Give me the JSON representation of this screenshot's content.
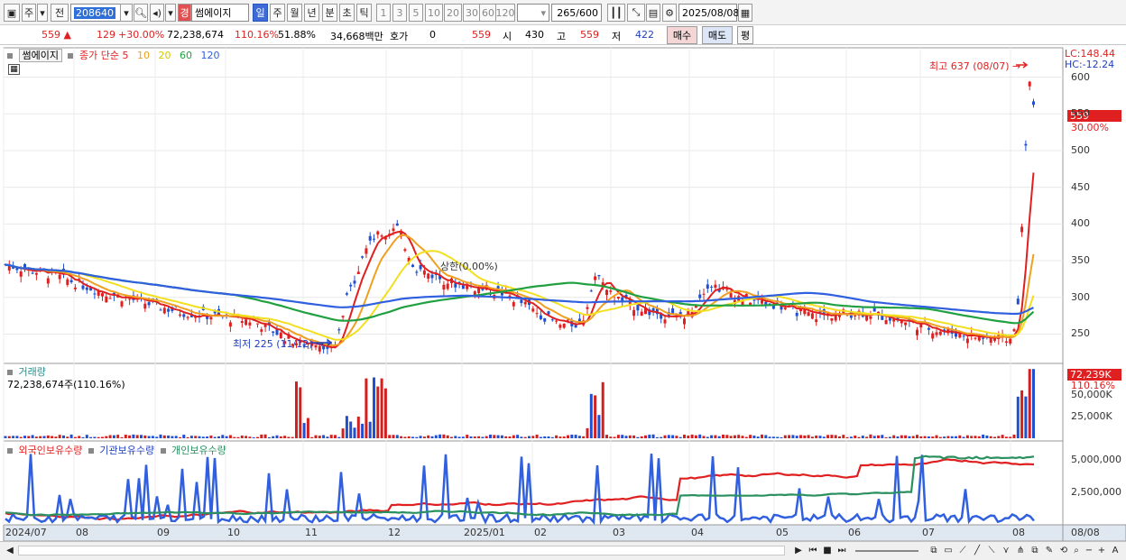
{
  "toolbar": {
    "period_prefix": "주",
    "period_full": "전",
    "stock_code": "208640",
    "stock_badge": "경",
    "stock_name": "썸에이지",
    "interval_tabs": [
      "일",
      "주",
      "월",
      "년",
      "분",
      "초",
      "틱"
    ],
    "active_interval": "일",
    "minute_options": [
      "1",
      "3",
      "5",
      "10",
      "20",
      "30",
      "60",
      "120"
    ],
    "count_value": "265",
    "count_total": "/600",
    "date_value": "2025/08/08"
  },
  "quote": {
    "price": "559",
    "change": "129",
    "change_pct": "+30.00%",
    "volume": "72,238,674",
    "volume_ratio": "110.16%",
    "turnover": "51.88%",
    "amount": "34,668백만",
    "bid_label": "호가",
    "bid_value": "0",
    "ask_value": "559",
    "open_label": "시",
    "open_value": "430",
    "high_label": "고",
    "high_value": "559",
    "low_label": "저",
    "low_value": "422",
    "buy_label": "매수",
    "sell_label": "매도",
    "eval_label": "평"
  },
  "price_panel": {
    "stock_tab": "썸에이지",
    "ma_label": "종가 단순",
    "ma_periods": [
      "5",
      "10",
      "20",
      "60",
      "120"
    ],
    "ma_colors": [
      "#e02020",
      "#f0a020",
      "#f2e020",
      "#20a040",
      "#3060e0"
    ],
    "lc_label": "LC:148.44",
    "hc_label": "HC:-12.24",
    "high_note": "최고 637 (08/07) →",
    "low_note": "최저 225 (11/12) →",
    "mid_note": "상한(0.00%)",
    "price_tag": "559",
    "price_tag_pct": "30.00%",
    "y_ticks": [
      "600",
      "550",
      "500",
      "450",
      "400",
      "350",
      "300",
      "250"
    ]
  },
  "volume_panel": {
    "title": "거래량",
    "summary": "72,238,674주(110.16%)",
    "vol_tag": "72,239K",
    "vol_tag_pct": "110.16%",
    "y_ticks": [
      "50,000K",
      "25,000K"
    ]
  },
  "holding_panel": {
    "series": [
      "외국인보유수량",
      "기관보유수량",
      "개인보유수량"
    ],
    "series_colors": [
      "#e02020",
      "#3060e0",
      "#2a9060"
    ],
    "y_ticks": [
      "5,000,000",
      "2,500,000"
    ]
  },
  "x_axis": {
    "labels": [
      "2024/07",
      "08",
      "09",
      "10",
      "11",
      "12",
      "2025/01",
      "02",
      "03",
      "04",
      "05",
      "06",
      "07",
      "08"
    ],
    "end_label": "08/08"
  },
  "chart_data": {
    "type": "line",
    "title": "썸에이지",
    "x": [
      "2024/07",
      "08",
      "09",
      "10",
      "11",
      "12",
      "2025/01",
      "02",
      "03",
      "04",
      "05",
      "06",
      "07",
      "08"
    ],
    "series": [
      {
        "name": "5",
        "values": [
          335,
          310,
          300,
          280,
          240,
          390,
          305,
          275,
          300,
          290,
          275,
          270,
          250,
          559
        ]
      },
      {
        "name": "120",
        "values": [
          355,
          340,
          325,
          310,
          300,
          305,
          300,
          298,
          296,
          298,
          300,
          290,
          278,
          280
        ]
      }
    ],
    "ylim": [
      210,
      640
    ],
    "xlabel": "",
    "ylabel": ""
  }
}
